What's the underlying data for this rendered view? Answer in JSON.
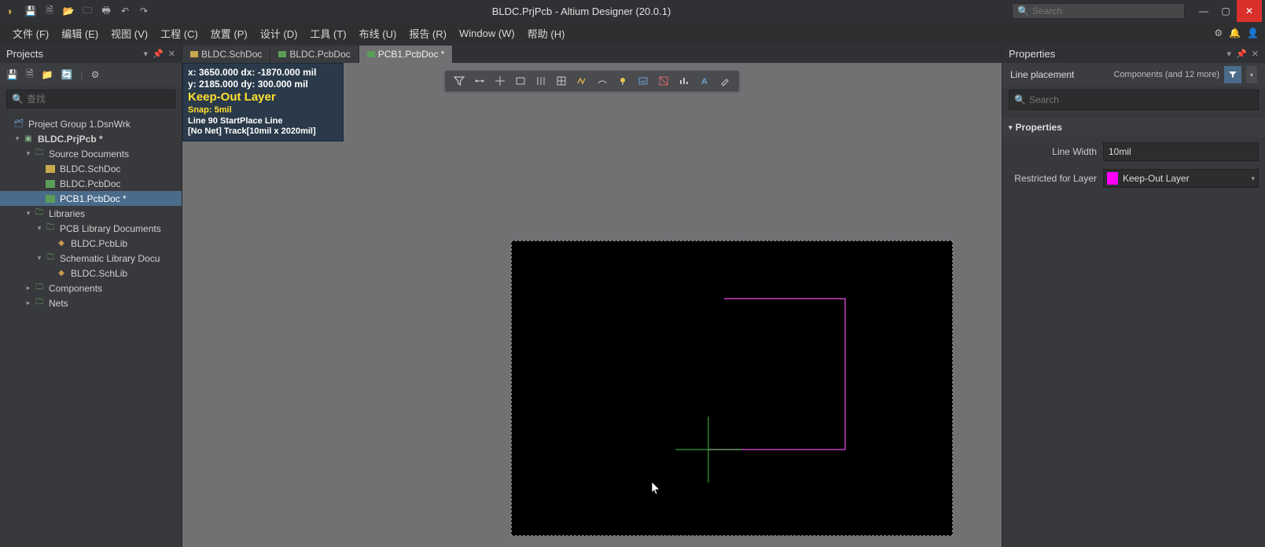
{
  "titlebar": {
    "title": "BLDC.PrjPcb - Altium Designer (20.0.1)",
    "search_placeholder": "Search"
  },
  "menu": {
    "file": "文件 (F)",
    "edit": "编辑 (E)",
    "view": "视图 (V)",
    "project": "工程 (C)",
    "place": "放置 (P)",
    "design": "设计 (D)",
    "tools": "工具 (T)",
    "route": "布线 (U)",
    "report": "报告 (R)",
    "window": "Window (W)",
    "help": "帮助 (H)"
  },
  "projects": {
    "title": "Projects",
    "search_placeholder": "查找",
    "tree": {
      "group": "Project Group 1.DsnWrk",
      "project": "BLDC.PrjPcb *",
      "source_docs": "Source Documents",
      "schdoc": "BLDC.SchDoc",
      "pcbdoc": "BLDC.PcbDoc",
      "pcb1doc": "PCB1.PcbDoc *",
      "libraries": "Libraries",
      "pcb_lib_docs": "PCB Library Documents",
      "pcblib": "BLDC.PcbLib",
      "sch_lib_docs": "Schematic Library Docu",
      "schlib": "BLDC.SchLib",
      "components": "Components",
      "nets": "Nets"
    }
  },
  "tabs": [
    {
      "label": "BLDC.SchDoc",
      "icon": "sch"
    },
    {
      "label": "BLDC.PcbDoc",
      "icon": "pcb"
    },
    {
      "label": "PCB1.PcbDoc *",
      "icon": "pcb",
      "active": true
    }
  ],
  "hud": {
    "line1": "x:  3650.000   dx: -1870.000 mil",
    "line2": "y:  2185.000   dy:   300.000  mil",
    "layer": "Keep-Out Layer",
    "snap": "Snap: 5mil",
    "info1": "Line 90 StartPlace Line",
    "info2": "[No Net] Track[10mil x 2020mil]"
  },
  "properties": {
    "title": "Properties",
    "subtitle": "Line placement",
    "subtitle_right": "Components (and 12 more)",
    "search_placeholder": "Search",
    "section": "Properties",
    "line_width_label": "Line Width",
    "line_width_value": "10mil",
    "layer_label": "Restricted for Layer",
    "layer_value": "Keep-Out Layer",
    "layer_color": "#ff00ff"
  }
}
